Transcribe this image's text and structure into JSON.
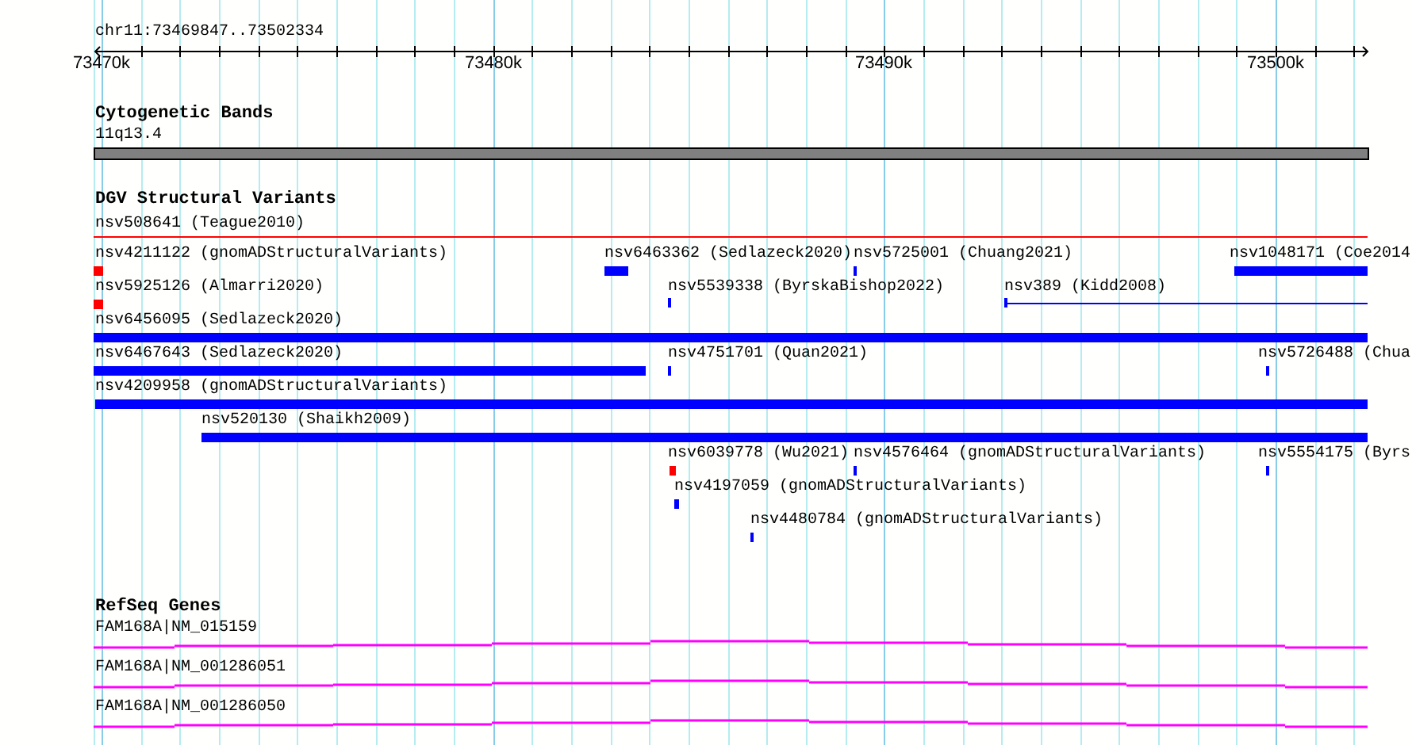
{
  "ruler": {
    "region": "chr11:73469847..73502334",
    "ticks": [
      "73470k",
      "73480k",
      "73490k",
      "73500k"
    ]
  },
  "tracks": [
    {
      "title": "Cytogenetic Bands",
      "kind": "bands",
      "features": [
        {
          "label": "11q13.4"
        }
      ]
    },
    {
      "title": "DGV Structural Variants",
      "kind": "variants",
      "features": [
        {
          "label": "nsv508641 (Teague2010)",
          "kind": "line",
          "color": "#ff0000"
        },
        {
          "label": "nsv4211122 (gnomADStructuralVariants)",
          "kind": "bar",
          "color": "#ff0000"
        },
        {
          "label": "nsv6463362 (Sedlazeck2020)",
          "kind": "bar",
          "color": "#0000ff"
        },
        {
          "label": "nsv5725001 (Chuang2021)",
          "kind": "bar",
          "color": "#0000ff"
        },
        {
          "label": "nsv1048171 (Coe2014",
          "kind": "bar",
          "color": "#0000ff"
        },
        {
          "label": "nsv5925126 (Almarri2020)",
          "kind": "bar",
          "color": "#ff0000"
        },
        {
          "label": "nsv5539338 (ByrskaBishop2022)",
          "kind": "bar",
          "color": "#0000ff"
        },
        {
          "label": "nsv389 (Kidd2008)",
          "kind": "line",
          "color": "#0000ff"
        },
        {
          "label": "nsv6456095 (Sedlazeck2020)",
          "kind": "bar",
          "color": "#0000ff"
        },
        {
          "label": "nsv6467643 (Sedlazeck2020)",
          "kind": "bar",
          "color": "#0000ff"
        },
        {
          "label": "nsv4751701 (Quan2021)",
          "kind": "bar",
          "color": "#0000ff"
        },
        {
          "label": "nsv5726488 (Chua",
          "kind": "bar",
          "color": "#0000ff"
        },
        {
          "label": "nsv4209958 (gnomADStructuralVariants)",
          "kind": "bar",
          "color": "#0000ff"
        },
        {
          "label": "nsv520130 (Shaikh2009)",
          "kind": "bar",
          "color": "#0000ff"
        },
        {
          "label": "nsv6039778 (Wu2021)",
          "kind": "bar",
          "color": "#ff0000"
        },
        {
          "label": "nsv4576464 (gnomADStructuralVariants)",
          "kind": "bar",
          "color": "#0000ff"
        },
        {
          "label": "nsv5554175 (Byrs",
          "kind": "bar",
          "color": "#0000ff"
        },
        {
          "label": "nsv4197059 (gnomADStructuralVariants)",
          "kind": "bar",
          "color": "#0000ff"
        },
        {
          "label": "nsv4480784 (gnomADStructuralVariants)",
          "kind": "bar",
          "color": "#0000ff"
        }
      ]
    },
    {
      "title": "RefSeq Genes",
      "kind": "genes",
      "features": [
        {
          "label": "FAM168A|NM_015159"
        },
        {
          "label": "FAM168A|NM_001286051"
        },
        {
          "label": "FAM168A|NM_001286050"
        }
      ]
    }
  ]
}
